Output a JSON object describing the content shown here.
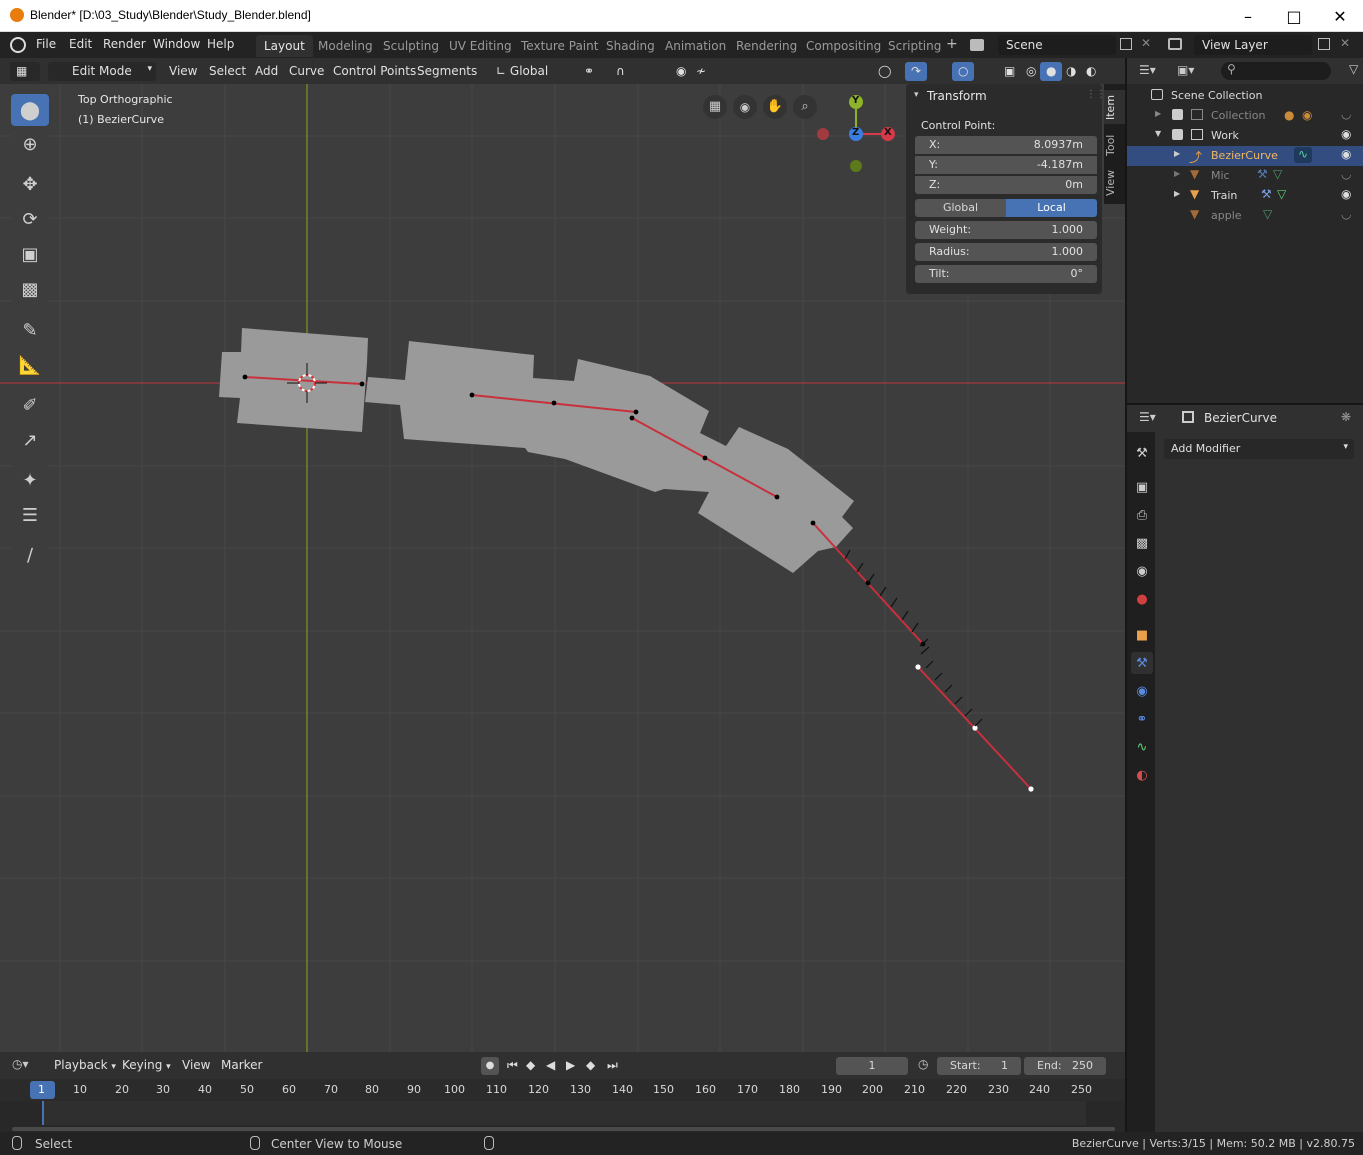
{
  "window": {
    "title": "Blender* [D:\\03_Study\\Blender\\Study_Blender.blend]"
  },
  "menu": [
    "File",
    "Edit",
    "Render",
    "Window",
    "Help"
  ],
  "workspaces": [
    "Layout",
    "Modeling",
    "Sculpting",
    "UV Editing",
    "Texture Paint",
    "Shading",
    "Animation",
    "Rendering",
    "Compositing",
    "Scripting"
  ],
  "active_workspace": "Layout",
  "scene": {
    "name": "Scene",
    "view_layer": "View Layer"
  },
  "viewport_header": {
    "mode": "Edit Mode",
    "items": [
      "View",
      "Select",
      "Add",
      "Curve",
      "Control Points",
      "Segments"
    ],
    "orientation": "Global"
  },
  "viewport": {
    "view_name": "Top Orthographic",
    "object_name": "(1) BezierCurve",
    "gizmo": {
      "x": "X",
      "y": "Y",
      "z": "Z"
    }
  },
  "transform_panel": {
    "title": "Transform",
    "section": "Control Point:",
    "x_label": "X:",
    "x_value": "8.0937m",
    "y_label": "Y:",
    "y_value": "-4.187m",
    "z_label": "Z:",
    "z_value": "0m",
    "global_label": "Global",
    "local_label": "Local",
    "weight_label": "Weight:",
    "weight_value": "1.000",
    "radius_label": "Radius:",
    "radius_value": "1.000",
    "tilt_label": "Tilt:",
    "tilt_value": "0°"
  },
  "n_tabs": [
    "Item",
    "Tool",
    "View"
  ],
  "outliner": {
    "root": "Scene Collection",
    "items": [
      {
        "name": "Collection",
        "dim": true
      },
      {
        "name": "Work",
        "dim": false
      },
      {
        "name": "BezierCurve",
        "selected": true
      },
      {
        "name": "Mic",
        "dim": true
      },
      {
        "name": "Train",
        "dim": false
      },
      {
        "name": "apple",
        "dim": true
      }
    ]
  },
  "properties": {
    "object": "BezierCurve",
    "add_modifier": "Add Modifier"
  },
  "timeline": {
    "menus": [
      "Playback",
      "Keying",
      "View",
      "Marker"
    ],
    "current_frame": "1",
    "start_label": "Start:",
    "start": "1",
    "end_label": "End:",
    "end": "250",
    "ticks": [
      "1",
      "10",
      "20",
      "30",
      "40",
      "50",
      "60",
      "70",
      "80",
      "90",
      "100",
      "110",
      "120",
      "130",
      "140",
      "150",
      "160",
      "170",
      "180",
      "190",
      "200",
      "210",
      "220",
      "230",
      "240",
      "250"
    ]
  },
  "status": {
    "left": "Select",
    "middle": "Center View to Mouse",
    "right": "BezierCurve | Verts:3/15 | Mem: 50.2 MB | v2.80.75"
  },
  "colors": {
    "accent": "#4772b3",
    "curve": "#d32f3a",
    "axis_x": "#a33a3f",
    "axis_y": "#8db32a",
    "mesh": "#9a9a9a"
  }
}
